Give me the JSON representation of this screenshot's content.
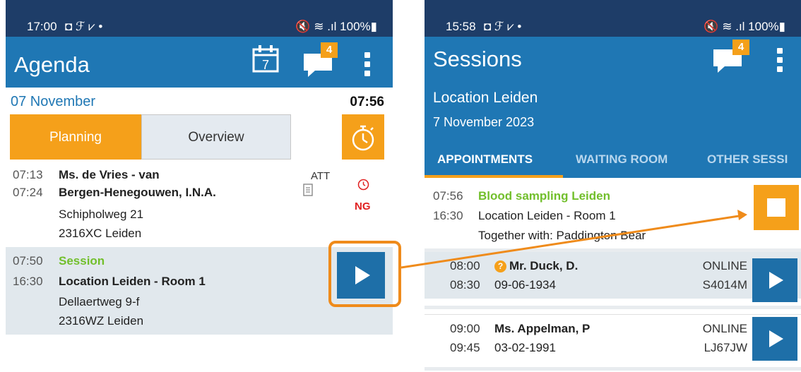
{
  "left_phone": {
    "status": {
      "time": "17:00",
      "indicators": "◘ ℱ ⩗ •",
      "right": "🔇 ≋ .ıl 100%▮"
    },
    "appbar": {
      "title": "Agenda",
      "calendar_day": "7",
      "chat_badge": "4"
    },
    "date_row": {
      "date": "07 November",
      "clock": "07:56"
    },
    "segments": {
      "planning": "Planning",
      "overview": "Overview"
    },
    "appointment": {
      "start": "07:13",
      "end": "07:24",
      "name_line1": "Ms. de Vries - van",
      "name_line2": "Bergen-Henegouwen, I.N.A.",
      "street": "Schipholweg 21",
      "city": "2316XC Leiden",
      "att": "ATT",
      "ng": "NG"
    },
    "session": {
      "start": "07:50",
      "end": "16:30",
      "label": "Session",
      "location": "Location Leiden - Room 1",
      "street": "Dellaertweg 9-f",
      "city": "2316WZ Leiden"
    }
  },
  "right_phone": {
    "status": {
      "time": "15:58",
      "indicators": "◘ ℱ ⩗ •",
      "right": "🔇 ≋ .ıl 100%▮"
    },
    "appbar": {
      "title": "Sessions",
      "chat_badge": "4"
    },
    "location": "Location Leiden",
    "date": "7 November 2023",
    "tabs": [
      "APPOINTMENTS",
      "WAITING ROOM",
      "OTHER SESSI"
    ],
    "session": {
      "start": "07:56",
      "end": "16:30",
      "name": "Blood sampling Leiden",
      "room": "Location Leiden - Room 1",
      "together": "Together with: Paddington Bear"
    },
    "patients": [
      {
        "start": "08:00",
        "end": "08:30",
        "name": "Mr. Duck, D.",
        "dob": "09-06-1934",
        "mode": "ONLINE",
        "code": "S4014M",
        "info": "?"
      },
      {
        "start": "09:00",
        "end": "09:45",
        "name": "Ms. Appelman, P",
        "dob": "03-02-1991",
        "mode": "ONLINE",
        "code": "LJ67JW"
      }
    ]
  },
  "colors": {
    "brand_blue": "#1f77b4",
    "status_bar": "#1e3d68",
    "accent_orange": "#f5a01a",
    "session_green": "#72bf2c",
    "alert_red": "#e02020"
  }
}
